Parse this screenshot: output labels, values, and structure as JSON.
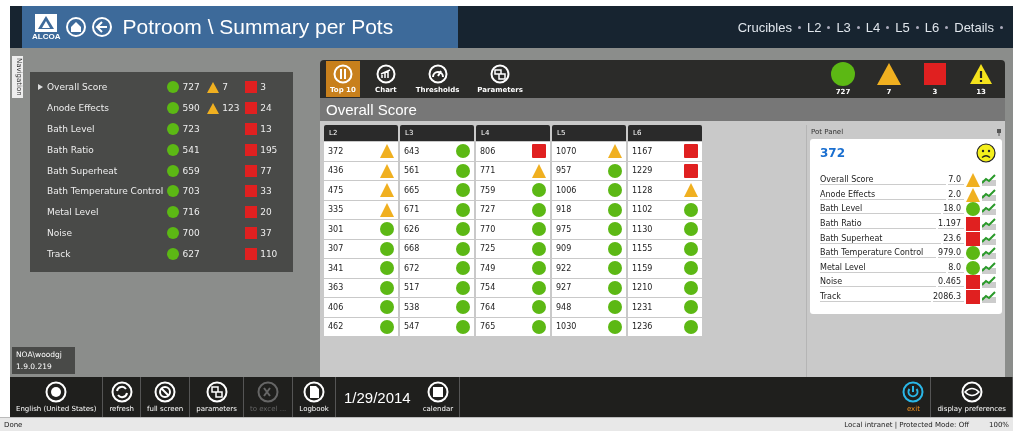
{
  "header": {
    "logo_text": "ALCOA",
    "title": "Potroom \\ Summary per Pots",
    "nav": [
      "Crucibles",
      "L2",
      "L3",
      "L4",
      "L5",
      "L6",
      "Details"
    ]
  },
  "navigation_tab": "Navigation",
  "summary": [
    {
      "label": "Overall Score",
      "selected": true,
      "good": "727",
      "warn": "7",
      "bad": "3"
    },
    {
      "label": "Anode Effects",
      "selected": false,
      "good": "590",
      "warn": "123",
      "bad": "24"
    },
    {
      "label": "Bath Level",
      "selected": false,
      "good": "723",
      "bad": "13"
    },
    {
      "label": "Bath Ratio",
      "selected": false,
      "good": "541",
      "bad": "195"
    },
    {
      "label": "Bath Superheat",
      "selected": false,
      "good": "659",
      "bad": "77"
    },
    {
      "label": "Bath Temperature Control",
      "selected": false,
      "good": "703",
      "bad": "33"
    },
    {
      "label": "Metal Level",
      "selected": false,
      "good": "716",
      "bad": "20"
    },
    {
      "label": "Noise",
      "selected": false,
      "good": "700",
      "bad": "37"
    },
    {
      "label": "Track",
      "selected": false,
      "good": "627",
      "bad": "110"
    }
  ],
  "user": {
    "name": "NOA\\woodgj",
    "version": "1.9.0.219"
  },
  "toolbar": {
    "tabs": [
      {
        "label": "Top 10",
        "kind": "top",
        "selected": true
      },
      {
        "label": "Chart",
        "kind": "chart",
        "selected": false
      },
      {
        "label": "Thresholds",
        "kind": "gauge",
        "selected": false
      },
      {
        "label": "Parameters",
        "kind": "params",
        "selected": false
      }
    ],
    "totals": [
      {
        "kind": "good",
        "value": "727"
      },
      {
        "kind": "warn",
        "value": "7"
      },
      {
        "kind": "bad",
        "value": "3"
      },
      {
        "kind": "alert",
        "value": "13"
      }
    ]
  },
  "section_title": "Overall Score",
  "table": {
    "columns": [
      {
        "name": "L2",
        "cells": [
          {
            "pot": "372",
            "kind": "warn"
          },
          {
            "pot": "436",
            "kind": "warn"
          },
          {
            "pot": "475",
            "kind": "warn"
          },
          {
            "pot": "335",
            "kind": "warn"
          },
          {
            "pot": "301",
            "kind": "good"
          },
          {
            "pot": "307",
            "kind": "good"
          },
          {
            "pot": "341",
            "kind": "good"
          },
          {
            "pot": "363",
            "kind": "good"
          },
          {
            "pot": "406",
            "kind": "good"
          },
          {
            "pot": "462",
            "kind": "good"
          }
        ]
      },
      {
        "name": "L3",
        "cells": [
          {
            "pot": "643",
            "kind": "good"
          },
          {
            "pot": "561",
            "kind": "good"
          },
          {
            "pot": "665",
            "kind": "good"
          },
          {
            "pot": "671",
            "kind": "good"
          },
          {
            "pot": "626",
            "kind": "good"
          },
          {
            "pot": "668",
            "kind": "good"
          },
          {
            "pot": "672",
            "kind": "good"
          },
          {
            "pot": "517",
            "kind": "good"
          },
          {
            "pot": "538",
            "kind": "good"
          },
          {
            "pot": "547",
            "kind": "good"
          }
        ]
      },
      {
        "name": "L4",
        "cells": [
          {
            "pot": "806",
            "kind": "bad"
          },
          {
            "pot": "771",
            "kind": "warn"
          },
          {
            "pot": "759",
            "kind": "good"
          },
          {
            "pot": "727",
            "kind": "good"
          },
          {
            "pot": "770",
            "kind": "good"
          },
          {
            "pot": "725",
            "kind": "good"
          },
          {
            "pot": "749",
            "kind": "good"
          },
          {
            "pot": "754",
            "kind": "good"
          },
          {
            "pot": "764",
            "kind": "good"
          },
          {
            "pot": "765",
            "kind": "good"
          }
        ]
      },
      {
        "name": "L5",
        "cells": [
          {
            "pot": "1070",
            "kind": "warn"
          },
          {
            "pot": "957",
            "kind": "good"
          },
          {
            "pot": "1006",
            "kind": "good"
          },
          {
            "pot": "918",
            "kind": "good"
          },
          {
            "pot": "975",
            "kind": "good"
          },
          {
            "pot": "909",
            "kind": "good"
          },
          {
            "pot": "922",
            "kind": "good"
          },
          {
            "pot": "927",
            "kind": "good"
          },
          {
            "pot": "948",
            "kind": "good"
          },
          {
            "pot": "1030",
            "kind": "good"
          }
        ]
      },
      {
        "name": "L6",
        "cells": [
          {
            "pot": "1167",
            "kind": "bad"
          },
          {
            "pot": "1229",
            "kind": "bad"
          },
          {
            "pot": "1128",
            "kind": "warn"
          },
          {
            "pot": "1102",
            "kind": "good"
          },
          {
            "pot": "1130",
            "kind": "good"
          },
          {
            "pot": "1155",
            "kind": "good"
          },
          {
            "pot": "1159",
            "kind": "good"
          },
          {
            "pot": "1210",
            "kind": "good"
          },
          {
            "pot": "1231",
            "kind": "good"
          },
          {
            "pot": "1236",
            "kind": "good"
          }
        ]
      }
    ]
  },
  "pot_panel": {
    "title": "Pot Panel",
    "pot": "372",
    "rows": [
      {
        "label": "Overall Score",
        "value": "7.0",
        "kind": "warn"
      },
      {
        "label": "Anode Effects",
        "value": "2.0",
        "kind": "warn"
      },
      {
        "label": "Bath Level",
        "value": "18.0",
        "kind": "good"
      },
      {
        "label": "Bath Ratio",
        "value": "1.197",
        "kind": "bad"
      },
      {
        "label": "Bath Superheat",
        "value": "23.6",
        "kind": "bad"
      },
      {
        "label": "Bath Temperature Control",
        "value": "979.0",
        "kind": "good"
      },
      {
        "label": "Metal Level",
        "value": "8.0",
        "kind": "good"
      },
      {
        "label": "Noise",
        "value": "0.465",
        "kind": "bad"
      },
      {
        "label": "Track",
        "value": "2086.3",
        "kind": "bad"
      }
    ]
  },
  "bottom_bar": {
    "left": [
      {
        "label": "English (United States)",
        "kind": "globe",
        "disabled": false
      },
      {
        "label": "refresh",
        "kind": "refresh",
        "disabled": false
      },
      {
        "label": "full screen",
        "kind": "screen",
        "disabled": false
      },
      {
        "label": "parameters",
        "kind": "params",
        "disabled": false
      },
      {
        "label": "to excel ...",
        "kind": "excel",
        "disabled": true
      },
      {
        "label": "Logbook",
        "kind": "doc",
        "disabled": false
      }
    ],
    "date": "1/29/2014",
    "calendar": "calendar",
    "right": [
      {
        "label": "exit",
        "kind": "power",
        "selected": true
      },
      {
        "label": "display preferences",
        "kind": "eye",
        "selected": false
      }
    ]
  },
  "status_bar": {
    "left": "Done",
    "zone": "Local intranet | Protected Mode: Off",
    "zoom": "100%"
  }
}
